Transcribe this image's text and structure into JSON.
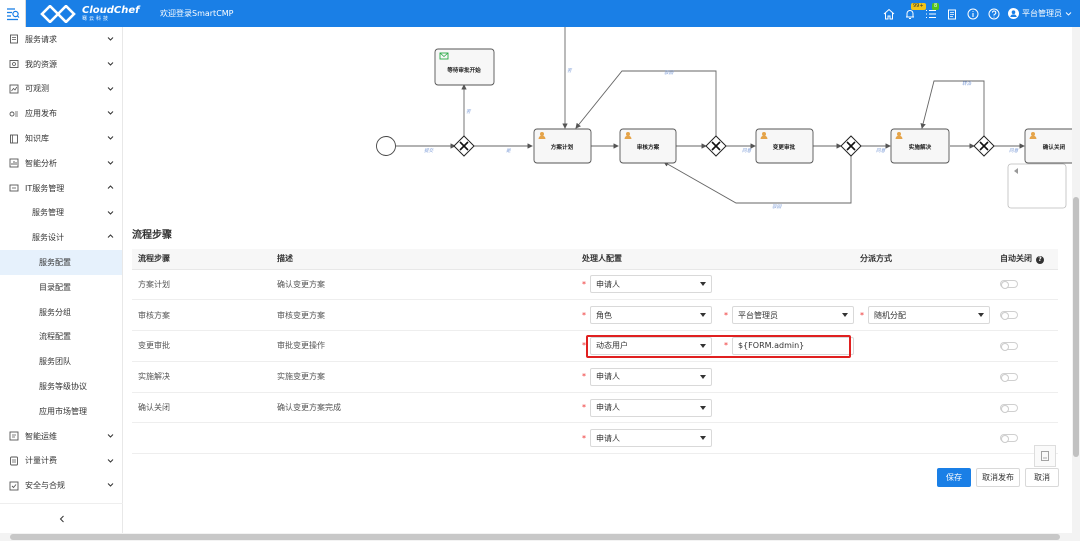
{
  "header": {
    "brand_name": "CloudChef",
    "brand_sub": "骞云科技",
    "welcome": "欢迎登录SmartCMP",
    "badge_bell": "99+",
    "badge_tasks": "8",
    "user_name": "平台管理员",
    "accent": "#1a7fe6"
  },
  "sidebar": {
    "items": [
      {
        "label": "服务请求",
        "icon": "document-icon"
      },
      {
        "label": "我的资源",
        "icon": "resource-icon"
      },
      {
        "label": "可观测",
        "icon": "chart-icon"
      },
      {
        "label": "应用发布",
        "icon": "app-icon"
      },
      {
        "label": "知识库",
        "icon": "book-icon"
      },
      {
        "label": "智能分析",
        "icon": "analysis-icon"
      },
      {
        "label": "IT服务管理",
        "icon": "it-service-icon"
      },
      {
        "label": "服务管理"
      },
      {
        "label": "服务设计"
      },
      {
        "label": "服务配置"
      },
      {
        "label": "目录配置"
      },
      {
        "label": "服务分组"
      },
      {
        "label": "流程配置"
      },
      {
        "label": "服务团队"
      },
      {
        "label": "服务等级协议"
      },
      {
        "label": "应用市场管理"
      },
      {
        "label": "智能运维",
        "icon": "ops-icon"
      },
      {
        "label": "计量计费",
        "icon": "billing-icon"
      },
      {
        "label": "安全与合规",
        "icon": "security-icon"
      }
    ]
  },
  "diagram": {
    "nodes": {
      "wait": "等待审批开始",
      "plan": "方案计划",
      "review": "审核方案",
      "change": "变更审批",
      "implement": "实施解决",
      "close": "确认关闭"
    },
    "edges": {
      "e1": "提交",
      "e2": "是",
      "e3": "否",
      "e4": "驳回",
      "e5": "同意",
      "e6": "驳回",
      "e7": "同意",
      "e8": "转派",
      "e9": "同意"
    }
  },
  "steps": {
    "title": "流程步骤",
    "columns": [
      "流程步骤",
      "描述",
      "处理人配置",
      "分派方式",
      "自动关闭"
    ],
    "rows": [
      {
        "step": "方案计划",
        "desc": "确认变更方案",
        "handler": "申请人"
      },
      {
        "step": "审核方案",
        "desc": "审核变更方案",
        "handler": "角色",
        "handler2": "平台管理员",
        "assign": "随机分配"
      },
      {
        "step": "变更审批",
        "desc": "审批变更操作",
        "handler": "动态用户",
        "handler2": "${FORM.admin}"
      },
      {
        "step": "实施解决",
        "desc": "实施变更方案",
        "handler": "申请人"
      },
      {
        "step": "确认关闭",
        "desc": "确认变更方案完成",
        "handler": "申请人"
      },
      {
        "step": "",
        "desc": "",
        "handler": "申请人"
      }
    ]
  },
  "actions": {
    "save": "保存",
    "unpublish": "取消发布",
    "cancel": "取消"
  }
}
